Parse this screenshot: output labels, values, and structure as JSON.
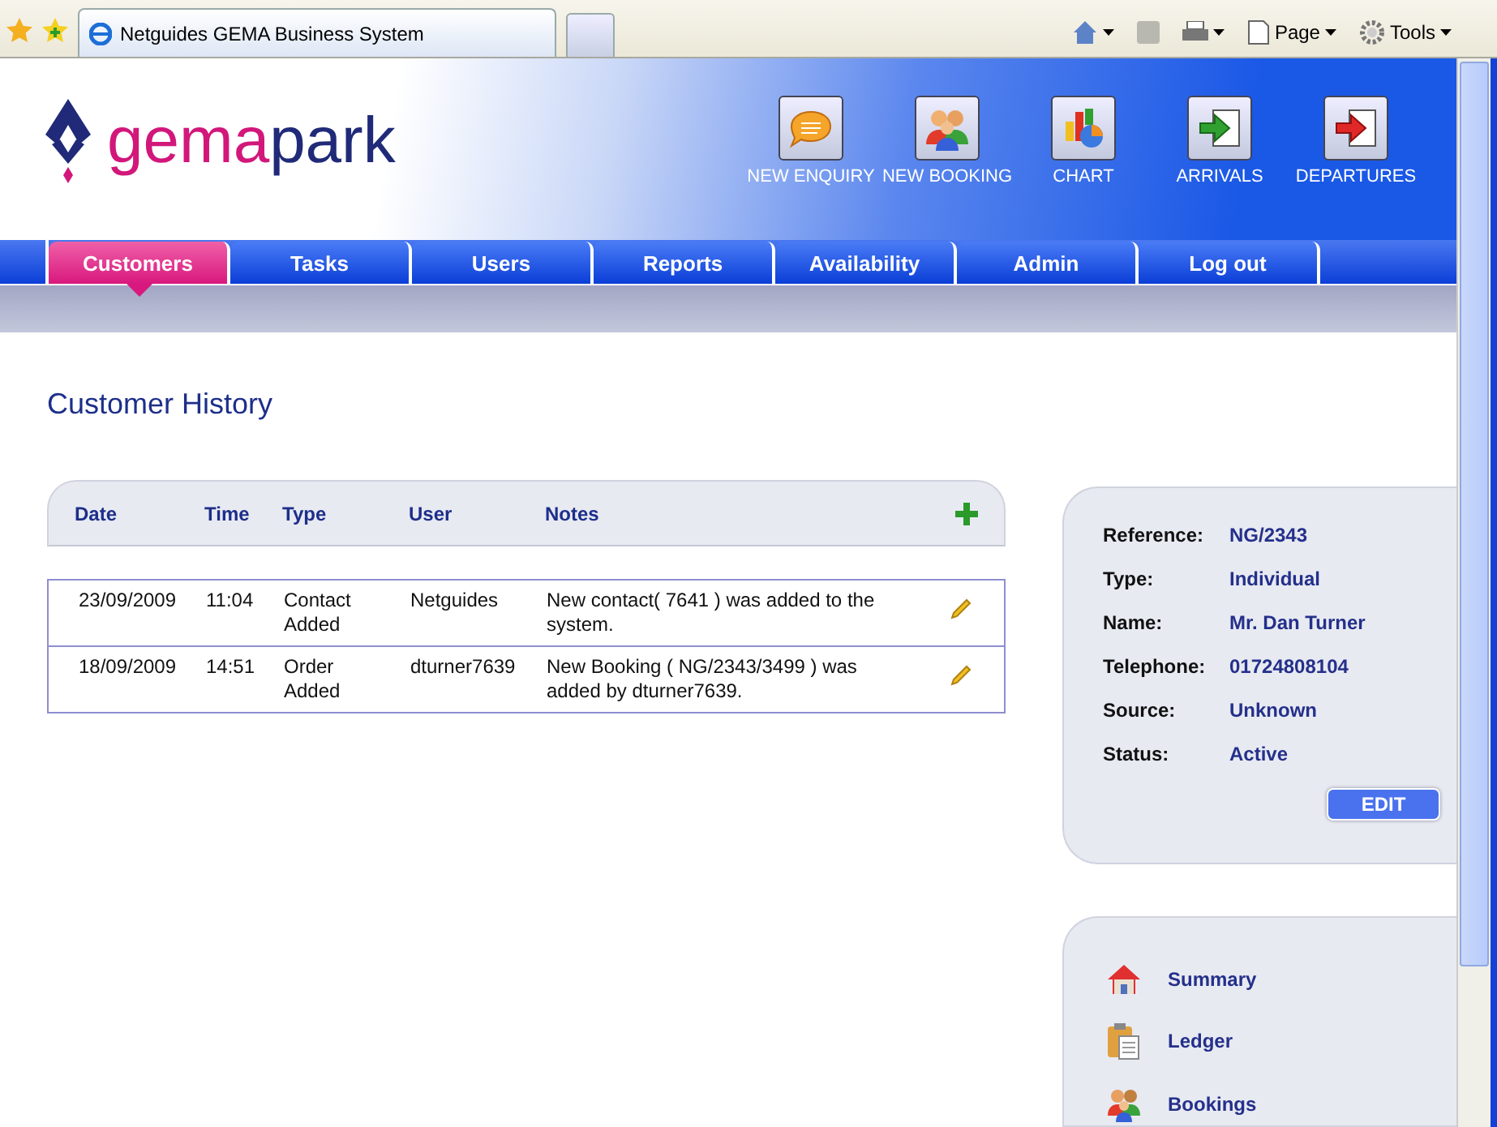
{
  "browser": {
    "tab_title": "Netguides GEMA Business System",
    "tools": [
      "Page",
      "Tools"
    ]
  },
  "logo": {
    "parts": [
      "gema",
      "park"
    ]
  },
  "actions": [
    {
      "label": "NEW ENQUIRY",
      "kind": "enquiry"
    },
    {
      "label": "NEW BOOKING",
      "kind": "booking"
    },
    {
      "label": "CHART",
      "kind": "chart"
    },
    {
      "label": "ARRIVALS",
      "kind": "arrivals"
    },
    {
      "label": "DEPARTURES",
      "kind": "departures"
    }
  ],
  "nav": [
    {
      "label": "Customers",
      "selected": true
    },
    {
      "label": "Tasks",
      "selected": false
    },
    {
      "label": "Users",
      "selected": false
    },
    {
      "label": "Reports",
      "selected": false
    },
    {
      "label": "Availability",
      "selected": false
    },
    {
      "label": "Admin",
      "selected": false
    },
    {
      "label": "Log out",
      "selected": false
    }
  ],
  "page_title": "Customer History",
  "history": {
    "columns": [
      "Date",
      "Time",
      "Type",
      "User",
      "Notes"
    ],
    "rows": [
      {
        "date": "23/09/2009",
        "time": "11:04",
        "type": "Contact Added",
        "user": "Netguides",
        "notes": "New contact( 7641 ) was added to the system."
      },
      {
        "date": "18/09/2009",
        "time": "14:51",
        "type": "Order Added",
        "user": "dturner7639",
        "notes": "New Booking ( NG/2343/3499 ) was added by dturner7639."
      }
    ]
  },
  "customer": {
    "fields": [
      {
        "label": "Reference:",
        "value": "NG/2343"
      },
      {
        "label": "Type:",
        "value": "Individual"
      },
      {
        "label": "Name:",
        "value": "Mr. Dan Turner"
      },
      {
        "label": "Telephone:",
        "value": "01724808104"
      },
      {
        "label": "Source:",
        "value": "Unknown"
      },
      {
        "label": "Status:",
        "value": "Active"
      }
    ],
    "edit_button": "EDIT"
  },
  "links": [
    {
      "label": "Summary",
      "kind": "home"
    },
    {
      "label": "Ledger",
      "kind": "clipboard"
    },
    {
      "label": "Bookings",
      "kind": "people"
    }
  ]
}
